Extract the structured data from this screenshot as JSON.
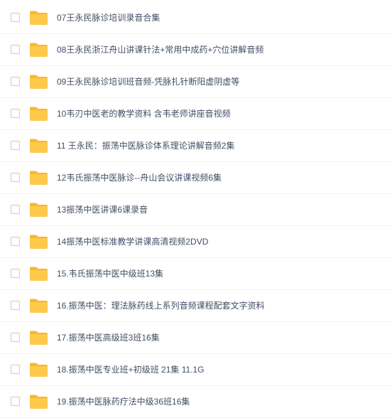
{
  "file_list": {
    "items": [
      {
        "name": "07王永民脉诊培训录音合集",
        "icon": "folder-icon",
        "checked": false
      },
      {
        "name": "08王永民浙江舟山讲课针法+常用中成药+穴位讲解音频",
        "icon": "folder-icon",
        "checked": false
      },
      {
        "name": "09王永民脉诊培训班音频-凭脉扎针断阳虚阴虚等",
        "icon": "folder-icon",
        "checked": false
      },
      {
        "name": "10韦刃中医老的教学资料 含韦老师讲座音视频",
        "icon": "folder-icon",
        "checked": false
      },
      {
        "name": "11 王永民：振荡中医脉诊体系理论讲解音频2集",
        "icon": "folder-icon",
        "checked": false
      },
      {
        "name": "12韦氏振荡中医脉诊--舟山会议讲课视频6集",
        "icon": "folder-icon",
        "checked": false
      },
      {
        "name": "13振荡中医讲课6课录音",
        "icon": "folder-icon",
        "checked": false
      },
      {
        "name": "14振荡中医标准教学讲课高清视频2DVD",
        "icon": "folder-icon",
        "checked": false
      },
      {
        "name": "15.韦氏振荡中医中级班13集",
        "icon": "folder-icon",
        "checked": false
      },
      {
        "name": "16.振荡中医：理法脉药线上系列音频课程配套文字资料",
        "icon": "folder-icon",
        "checked": false
      },
      {
        "name": "17.振荡中医高级班3班16集",
        "icon": "folder-icon",
        "checked": false
      },
      {
        "name": "18.振荡中医专业班+初级班 21集 11.1G",
        "icon": "folder-icon",
        "checked": false
      },
      {
        "name": "19.振荡中医脉药疗法中级36班16集",
        "icon": "folder-icon",
        "checked": false
      }
    ]
  },
  "colors": {
    "folder": "#ffc94a",
    "folder_tab": "#f5b82e",
    "text": "#424e67",
    "checkbox_border": "#c8ccd4"
  }
}
